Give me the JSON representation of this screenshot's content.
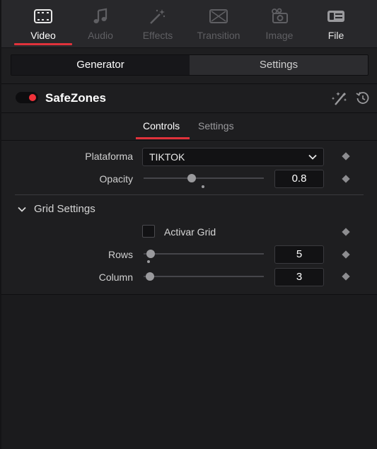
{
  "tabs": [
    {
      "label": "Video",
      "icon": "video-icon",
      "state": "active"
    },
    {
      "label": "Audio",
      "icon": "audio-icon",
      "state": "disabled"
    },
    {
      "label": "Effects",
      "icon": "effects-icon",
      "state": "disabled"
    },
    {
      "label": "Transition",
      "icon": "transition-icon",
      "state": "disabled"
    },
    {
      "label": "Image",
      "icon": "image-icon",
      "state": "disabled"
    },
    {
      "label": "File",
      "icon": "file-icon",
      "state": "enabled"
    }
  ],
  "segment": {
    "generator": "Generator",
    "settings": "Settings",
    "active": "generator"
  },
  "effect": {
    "title": "SafeZones",
    "enabled": true,
    "enabled_color": "#f0323a"
  },
  "subtabs": {
    "controls": "Controls",
    "settings": "Settings",
    "active": "controls"
  },
  "params": {
    "plataforma": {
      "label": "Plataforma",
      "value": "TIKTOK"
    },
    "opacity": {
      "label": "Opacity",
      "value": "0.8",
      "slider_fraction": 0.4
    },
    "grid_settings": {
      "label": "Grid Settings",
      "expanded": true
    },
    "activar_grid": {
      "label": "Activar Grid",
      "checked": false
    },
    "rows": {
      "label": "Rows",
      "value": "5",
      "slider_fraction": 0.06
    },
    "column": {
      "label": "Column",
      "value": "3",
      "slider_fraction": 0.05
    }
  },
  "accent_color": "#e0323b"
}
